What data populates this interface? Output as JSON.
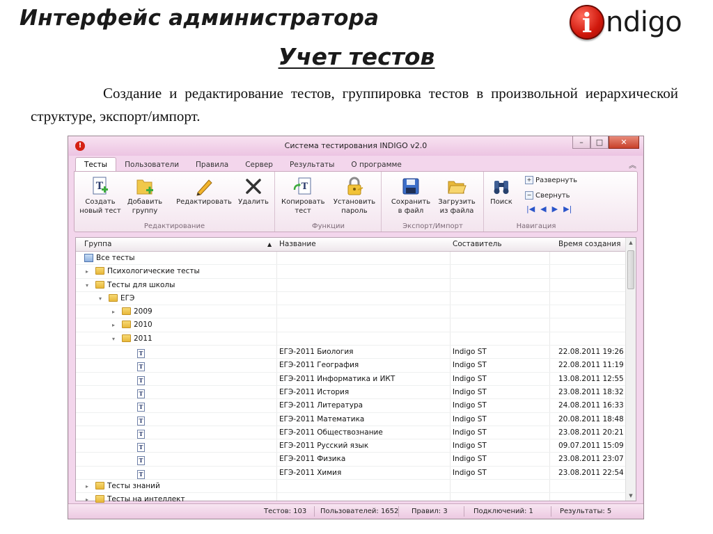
{
  "slide": {
    "title": "Интерфейс администратора",
    "subtitle": "Учет тестов",
    "description": "Создание и редактирование тестов, группировка тестов в произвольной иерархической структуре, экспорт/импорт.",
    "logo": {
      "letter": "i",
      "text": "ndigo"
    }
  },
  "window": {
    "title": "Система тестирования INDIGO v2.0",
    "controls": {
      "minimize": "–",
      "maximize": "□",
      "close": "✕"
    },
    "tabs": [
      "Тесты",
      "Пользователи",
      "Правила",
      "Сервер",
      "Результаты",
      "О программе"
    ],
    "active_tab": "Тесты"
  },
  "ribbon": {
    "groups": [
      {
        "label": "Редактирование"
      },
      {
        "label": "Функции"
      },
      {
        "label": "Экспорт/Импорт"
      },
      {
        "label": "Навигация"
      }
    ],
    "buttons": {
      "create_test": "Создать\nновый тест",
      "add_group": "Добавить\nгруппу",
      "edit": "Редактировать",
      "delete": "Удалить",
      "copy_test": "Копировать\nтест",
      "set_password": "Установить\nпароль",
      "save_file": "Сохранить\nв файл",
      "load_file": "Загрузить\nиз файла",
      "search": "Поиск",
      "expand": "Развернуть",
      "collapse": "Свернуть"
    }
  },
  "grid": {
    "columns": [
      "Группа",
      "Название",
      "Составитель",
      "Время создания"
    ],
    "rows": [
      {
        "level": 0,
        "type": "all",
        "group": "Все тесты"
      },
      {
        "level": 1,
        "type": "folder",
        "caret": "▸",
        "group": "Психологические тесты"
      },
      {
        "level": 1,
        "type": "folder",
        "caret": "▾",
        "group": "Тесты для школы"
      },
      {
        "level": 2,
        "type": "folder",
        "caret": "▾",
        "group": "ЕГЭ"
      },
      {
        "level": 3,
        "type": "folder",
        "caret": "▸",
        "group": "2009"
      },
      {
        "level": 3,
        "type": "folder",
        "caret": "▸",
        "group": "2010"
      },
      {
        "level": 3,
        "type": "folder",
        "caret": "▾",
        "group": "2011"
      },
      {
        "level": 4,
        "type": "test",
        "name": "ЕГЭ-2011 Биология",
        "author": "Indigo ST",
        "created": "22.08.2011 19:26"
      },
      {
        "level": 4,
        "type": "test",
        "name": "ЕГЭ-2011 География",
        "author": "Indigo ST",
        "created": "22.08.2011 11:19"
      },
      {
        "level": 4,
        "type": "test",
        "name": "ЕГЭ-2011 Информатика и ИКТ",
        "author": "Indigo ST",
        "created": "13.08.2011 12:55"
      },
      {
        "level": 4,
        "type": "test",
        "name": "ЕГЭ-2011 История",
        "author": "Indigo ST",
        "created": "23.08.2011 18:32"
      },
      {
        "level": 4,
        "type": "test",
        "name": "ЕГЭ-2011 Литература",
        "author": "Indigo ST",
        "created": "24.08.2011 16:33"
      },
      {
        "level": 4,
        "type": "test",
        "name": "ЕГЭ-2011 Математика",
        "author": "Indigo ST",
        "created": "20.08.2011 18:48"
      },
      {
        "level": 4,
        "type": "test",
        "name": "ЕГЭ-2011 Обществознание",
        "author": "Indigo ST",
        "created": "23.08.2011 20:21"
      },
      {
        "level": 4,
        "type": "test",
        "name": "ЕГЭ-2011 Русский язык",
        "author": "Indigo ST",
        "created": "09.07.2011 15:09"
      },
      {
        "level": 4,
        "type": "test",
        "name": "ЕГЭ-2011 Физика",
        "author": "Indigo ST",
        "created": "23.08.2011 23:07"
      },
      {
        "level": 4,
        "type": "test",
        "name": "ЕГЭ-2011 Химия",
        "author": "Indigo ST",
        "created": "23.08.2011 22:54"
      },
      {
        "level": 1,
        "type": "folder",
        "caret": "▸",
        "group": "Тесты знаний"
      },
      {
        "level": 1,
        "type": "folder",
        "caret": "▸",
        "group": "Тесты на интеллект"
      }
    ]
  },
  "status": {
    "tests": "Тестов: 103",
    "users": "Пользователей: 1652",
    "rules": "Правил: 3",
    "connections": "Подключений: 1",
    "results": "Результаты: 5"
  }
}
